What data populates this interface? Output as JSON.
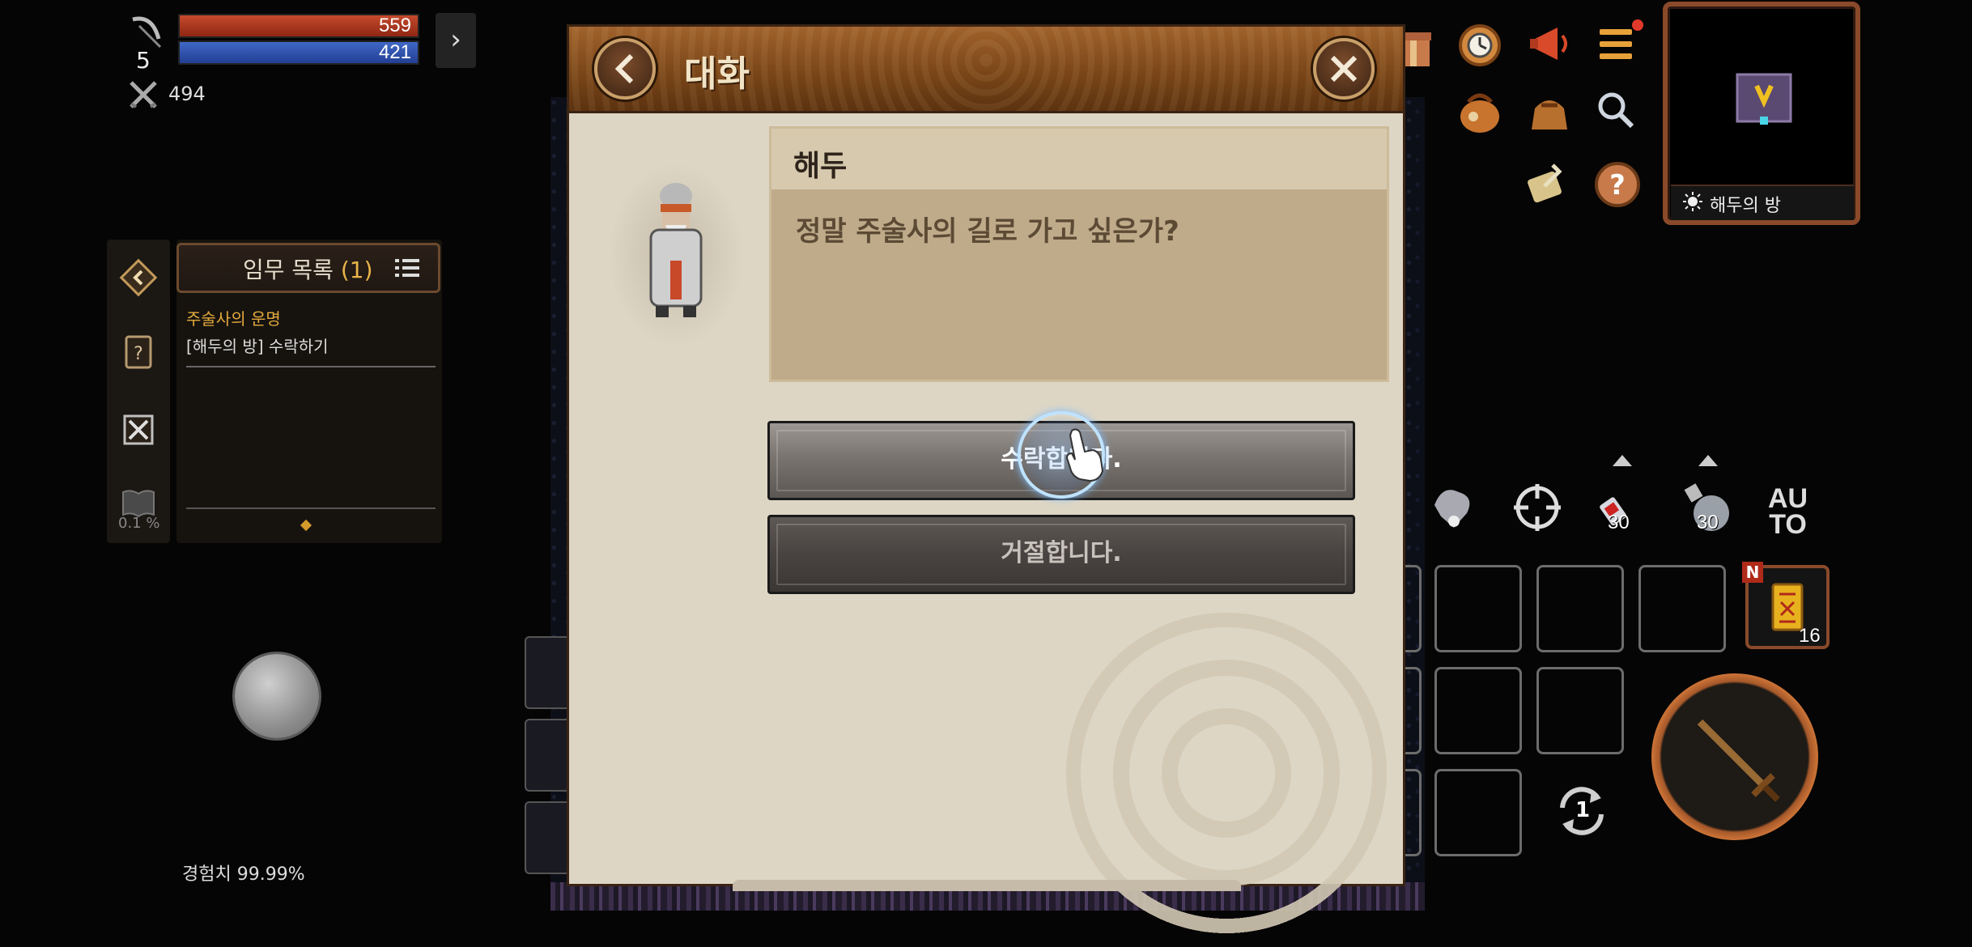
{
  "status": {
    "level": "5",
    "hp": "559",
    "mp": "421",
    "power": "494",
    "expand_glyph": "›"
  },
  "quest": {
    "title": "임무 목록",
    "count": "(1)",
    "name": "주술사의 운명",
    "task": "[해두의 방] 수락하기",
    "progress": "0.1 %"
  },
  "exp_label": "경험치 99.99%",
  "dialog": {
    "title": "대화",
    "speaker": "해두",
    "text": "정말 주술사의 길로 가고 싶은가?",
    "choices": [
      {
        "label": "수락합니다."
      },
      {
        "label": "거절합니다."
      }
    ]
  },
  "minimap": {
    "location": "해두의 방"
  },
  "hud": {
    "potion_red_qty": "30",
    "potion_bomb_qty": "30",
    "auto_label_line1": "AU",
    "auto_label_line2": "TO",
    "scroll_qty": "16",
    "new_badge": "N",
    "swap_count": "1"
  },
  "icons": {
    "back": "chevron-left-icon",
    "close": "close-icon",
    "menu": "hamburger-icon",
    "search": "search-icon",
    "help": "question-icon"
  },
  "colors": {
    "hp": "#c54a2c",
    "mp": "#3f68c7",
    "dialog_header": "#7a4618",
    "quest_accent": "#e3a93c",
    "notification": "#e23a2a"
  }
}
